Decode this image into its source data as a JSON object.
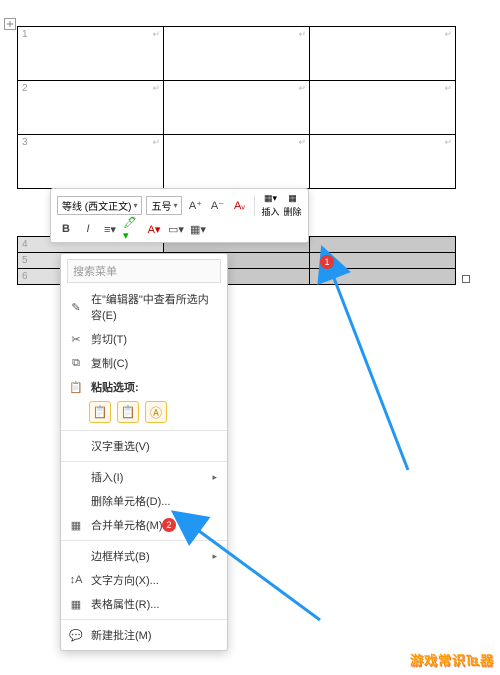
{
  "table": {
    "big_rows": [
      "1",
      "2",
      "3"
    ],
    "small_rows": [
      "4",
      "5",
      "6"
    ]
  },
  "toolbar": {
    "font_family": "等线 (西文正文)",
    "font_size": "五号",
    "increase_label": "A⁺",
    "decrease_label": "A⁻",
    "format_painter": "格",
    "bold": "B",
    "italic": "I",
    "insert_label": "插入",
    "delete_label": "删除"
  },
  "menu": {
    "search_placeholder": "搜索菜单",
    "items": {
      "lookup": "在\"编辑器\"中查看所选内容(E)",
      "cut": "剪切(T)",
      "copy": "复制(C)",
      "paste_header": "粘贴选项:",
      "hanzi": "汉字重选(V)",
      "insert": "插入(I)",
      "delete_cells": "删除单元格(D)...",
      "merge_cells": "合并单元格(M)",
      "border_style": "边框样式(B)",
      "text_direction": "文字方向(X)...",
      "table_props": "表格属性(R)...",
      "new_comment": "新建批注(M)"
    }
  },
  "badges": {
    "one": "1",
    "two": "2"
  },
  "watermark": "游戏常识℡器"
}
